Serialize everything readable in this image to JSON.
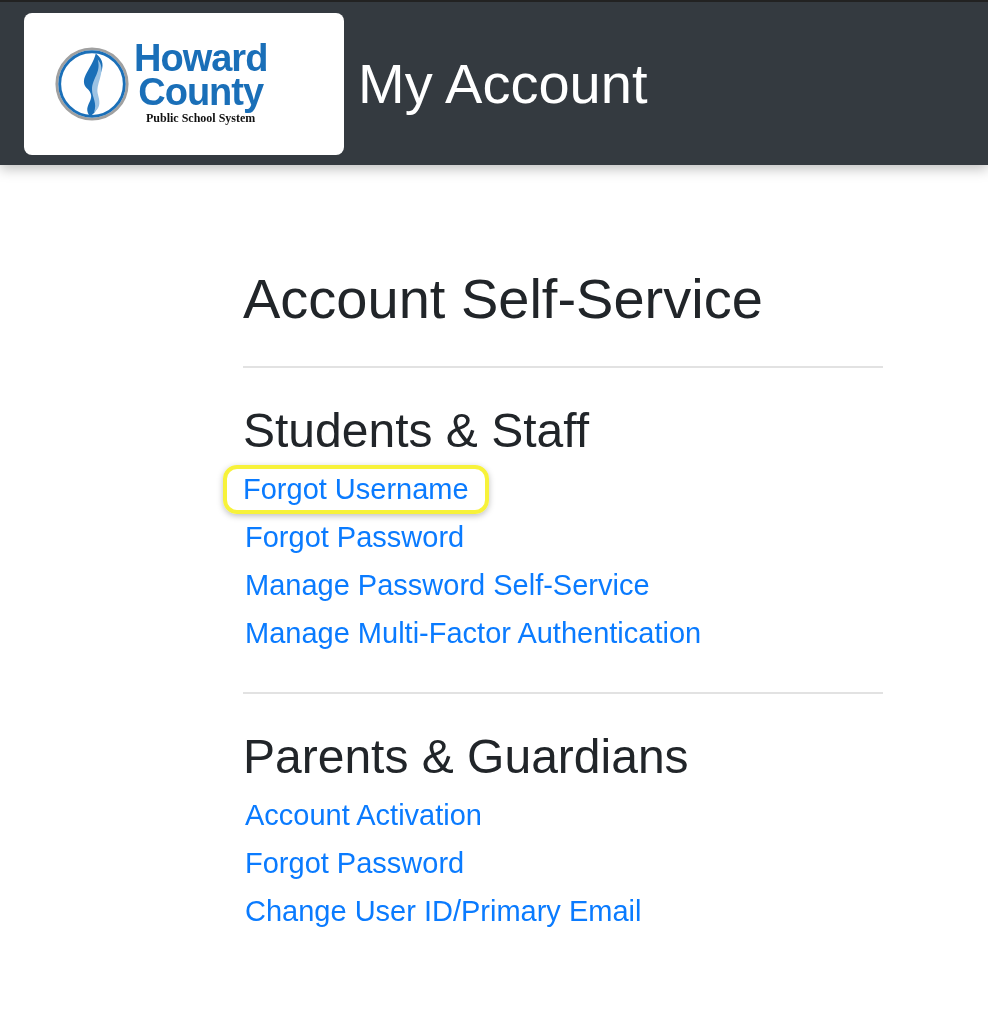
{
  "header": {
    "logo": {
      "line_1": "Howard",
      "line_2": "County",
      "line_3": "Public School System"
    },
    "title": "My Account"
  },
  "page_title": "Account Self-Service",
  "sections": [
    {
      "heading": "Students & Staff",
      "links": [
        {
          "label": "Forgot Username",
          "highlighted": true
        },
        {
          "label": "Forgot Password",
          "highlighted": false
        },
        {
          "label": "Manage Password Self-Service",
          "highlighted": false
        },
        {
          "label": "Manage Multi-Factor Authentication",
          "highlighted": false
        }
      ]
    },
    {
      "heading": "Parents & Guardians",
      "links": [
        {
          "label": "Account Activation",
          "highlighted": false
        },
        {
          "label": "Forgot Password",
          "highlighted": false
        },
        {
          "label": "Change User ID/Primary Email",
          "highlighted": false
        }
      ]
    }
  ]
}
